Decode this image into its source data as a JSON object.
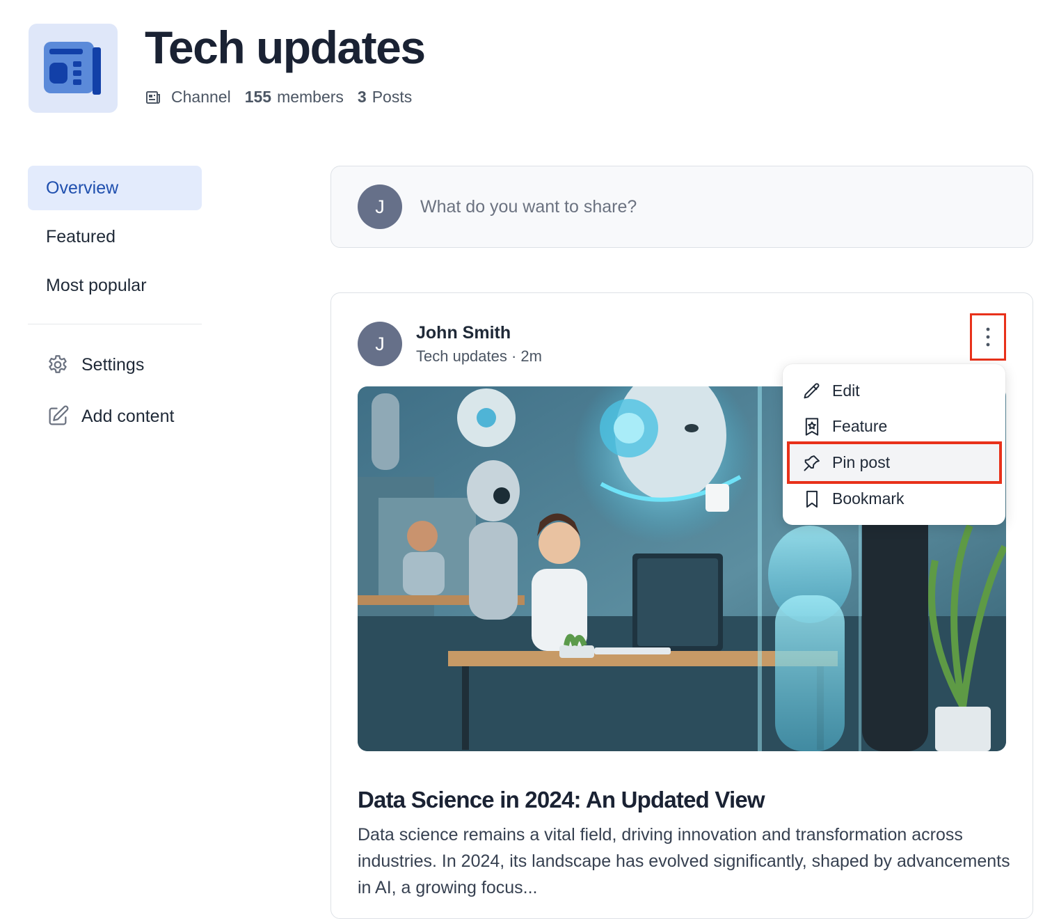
{
  "channel": {
    "title": "Tech updates",
    "type_label": "Channel",
    "members_count": "155",
    "members_label": "members",
    "posts_count": "3",
    "posts_label": "Posts",
    "logo_icon": "news-feed-icon"
  },
  "sidebar": {
    "items": [
      {
        "label": "Overview",
        "active": true
      },
      {
        "label": "Featured",
        "active": false
      },
      {
        "label": "Most popular",
        "active": false
      }
    ],
    "actions": [
      {
        "label": "Settings",
        "icon": "gear-icon"
      },
      {
        "label": "Add content",
        "icon": "edit-square-icon"
      }
    ]
  },
  "composer": {
    "avatar_initial": "J",
    "placeholder": "What do you want to share?"
  },
  "post": {
    "avatar_initial": "J",
    "author": "John Smith",
    "channel": "Tech updates",
    "time": "2m",
    "subtitle": "Tech updates · 2m",
    "title": "Data Science in 2024: An Updated View",
    "excerpt": "Data science remains a vital field, driving innovation and transformation across industries. In 2024, its landscape has evolved significantly, shaped by advancements in AI, a growing focus...",
    "menu": [
      {
        "label": "Edit",
        "icon": "pencil-icon"
      },
      {
        "label": "Feature",
        "icon": "star-badge-icon"
      },
      {
        "label": "Pin post",
        "icon": "pin-icon",
        "highlighted": true
      },
      {
        "label": "Bookmark",
        "icon": "bookmark-icon"
      }
    ]
  },
  "colors": {
    "accent": "#1f4fae",
    "active_nav_bg": "#e3ebfc",
    "avatar_bg": "#667089",
    "highlight_border": "#e8311a"
  }
}
